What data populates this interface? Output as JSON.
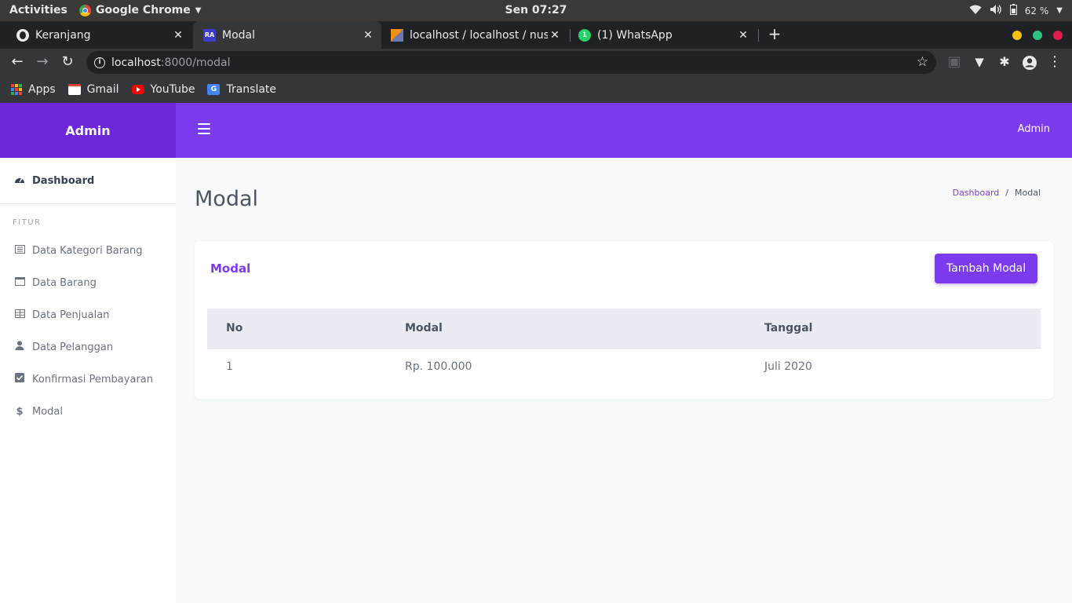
{
  "system": {
    "activities": "Activities",
    "app_name": "Google Chrome",
    "clock": "Sen 07:27",
    "battery": "62 %"
  },
  "browser": {
    "tabs": [
      {
        "title": "Keranjang",
        "icon": "globe-icon"
      },
      {
        "title": "Modal",
        "icon": "ra-favicon"
      },
      {
        "title": "localhost / localhost / nus",
        "icon": "phpmyadmin-icon"
      },
      {
        "title": "(1) WhatsApp",
        "icon": "whatsapp-icon"
      }
    ],
    "url_host": "localhost",
    "url_path": ":8000/modal",
    "bookmarks": [
      {
        "label": "Apps",
        "icon": "apps-grid-icon"
      },
      {
        "label": "Gmail",
        "icon": "gmail-icon"
      },
      {
        "label": "YouTube",
        "icon": "youtube-icon"
      },
      {
        "label": "Translate",
        "icon": "translate-icon"
      }
    ]
  },
  "app": {
    "brand": "Admin",
    "user": "Admin",
    "colors": {
      "brand_dark": "#6d28d9",
      "brand": "#7c3aed"
    }
  },
  "sidebar": {
    "dashboard": "Dashboard",
    "heading": "FITUR",
    "items": [
      {
        "label": "Data Kategori Barang",
        "icon": "list-icon"
      },
      {
        "label": "Data Barang",
        "icon": "window-icon"
      },
      {
        "label": "Data Penjualan",
        "icon": "table-icon"
      },
      {
        "label": "Data Pelanggan",
        "icon": "user-icon"
      },
      {
        "label": "Konfirmasi Pembayaran",
        "icon": "check-square-icon"
      },
      {
        "label": "Modal",
        "icon": "dollar-icon"
      }
    ]
  },
  "page": {
    "title": "Modal",
    "breadcrumb": {
      "link": "Dashboard",
      "separator": "/",
      "current": "Modal"
    }
  },
  "card": {
    "title": "Modal",
    "add_button": "Tambah Modal",
    "table": {
      "headers": [
        "No",
        "Modal",
        "Tanggal"
      ],
      "rows": [
        [
          "1",
          "Rp. 100.000",
          "Juli 2020"
        ]
      ]
    }
  }
}
